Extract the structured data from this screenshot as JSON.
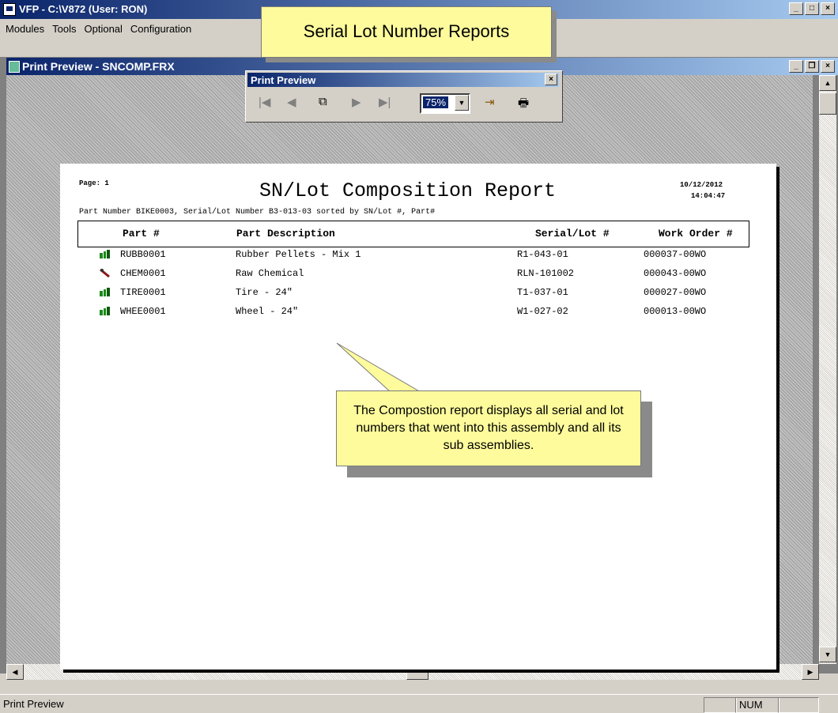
{
  "app": {
    "title": "VFP - C:\\V872  (User: RON)"
  },
  "menu": [
    "Modules",
    "Tools",
    "Optional",
    "Configuration"
  ],
  "child_window": {
    "title": "Print Preview - SNCOMP.FRX"
  },
  "toolbar": {
    "title": "Print Preview",
    "zoom": "75%"
  },
  "callouts": {
    "top": "Serial Lot Number Reports",
    "body": "The Compostion report displays all serial and lot numbers that went into this assembly and all its sub assemblies."
  },
  "report": {
    "page_label": "Page: 1",
    "title": "SN/Lot Composition Report",
    "date": "10/12/2012",
    "time": "14:04:47",
    "subtitle": "Part Number BIKE0003, Serial/Lot Number B3-013-03 sorted by SN/Lot #, Part#",
    "columns": [
      "Part #",
      "Part Description",
      "Serial/Lot #",
      "Work Order #"
    ],
    "rows": [
      {
        "part": "RUBB0001",
        "description": "Rubber Pellets - Mix 1",
        "serial": "R1-043-01",
        "wo": "000037-00WO",
        "icon": "green"
      },
      {
        "part": "CHEM0001",
        "description": "Raw Chemical",
        "serial": "RLN-101002",
        "wo": "000043-00WO",
        "icon": "red"
      },
      {
        "part": "TIRE0001",
        "description": "Tire - 24\"",
        "serial": "T1-037-01",
        "wo": "000027-00WO",
        "icon": "green"
      },
      {
        "part": "WHEE0001",
        "description": "Wheel - 24\"",
        "serial": "W1-027-02",
        "wo": "000013-00WO",
        "icon": "green"
      }
    ]
  },
  "status": {
    "text": "Print Preview",
    "num": "NUM"
  }
}
